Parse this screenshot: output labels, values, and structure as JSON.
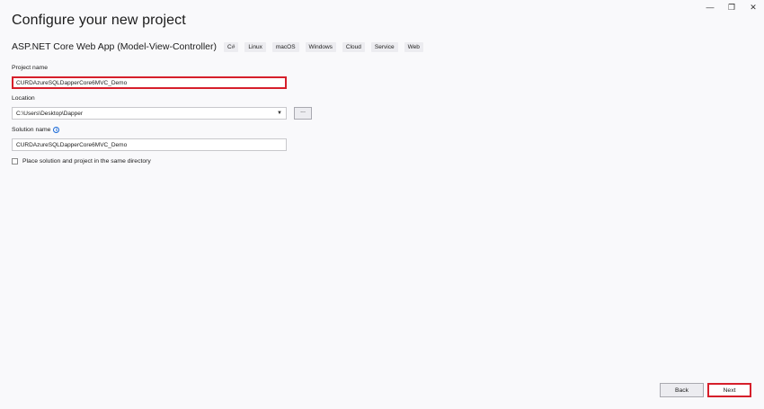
{
  "window": {
    "title": "Configure your new project",
    "controls": {
      "minimize": "—",
      "restore": "❐",
      "close": "✕"
    }
  },
  "template": {
    "name": "ASP.NET Core Web App (Model-View-Controller)",
    "tags": [
      "C#",
      "Linux",
      "macOS",
      "Windows",
      "Cloud",
      "Service",
      "Web"
    ]
  },
  "project_name": {
    "label": "Project name",
    "value": "CURDAzureSQLDapperCore6MVC_Demo"
  },
  "location": {
    "label": "Location",
    "value": "C:\\Users\\Desktop\\Dapper",
    "browse_label": "..."
  },
  "solution_name": {
    "label": "Solution name",
    "value": "CURDAzureSQLDapperCore6MVC_Demo"
  },
  "same_directory": {
    "label": "Place solution and project in the same directory",
    "checked": false
  },
  "footer": {
    "back_label": "Back",
    "next_label": "Next"
  },
  "colors": {
    "highlight": "#d61f2b",
    "info": "#1a6ad8",
    "background": "#f9f9fb"
  }
}
